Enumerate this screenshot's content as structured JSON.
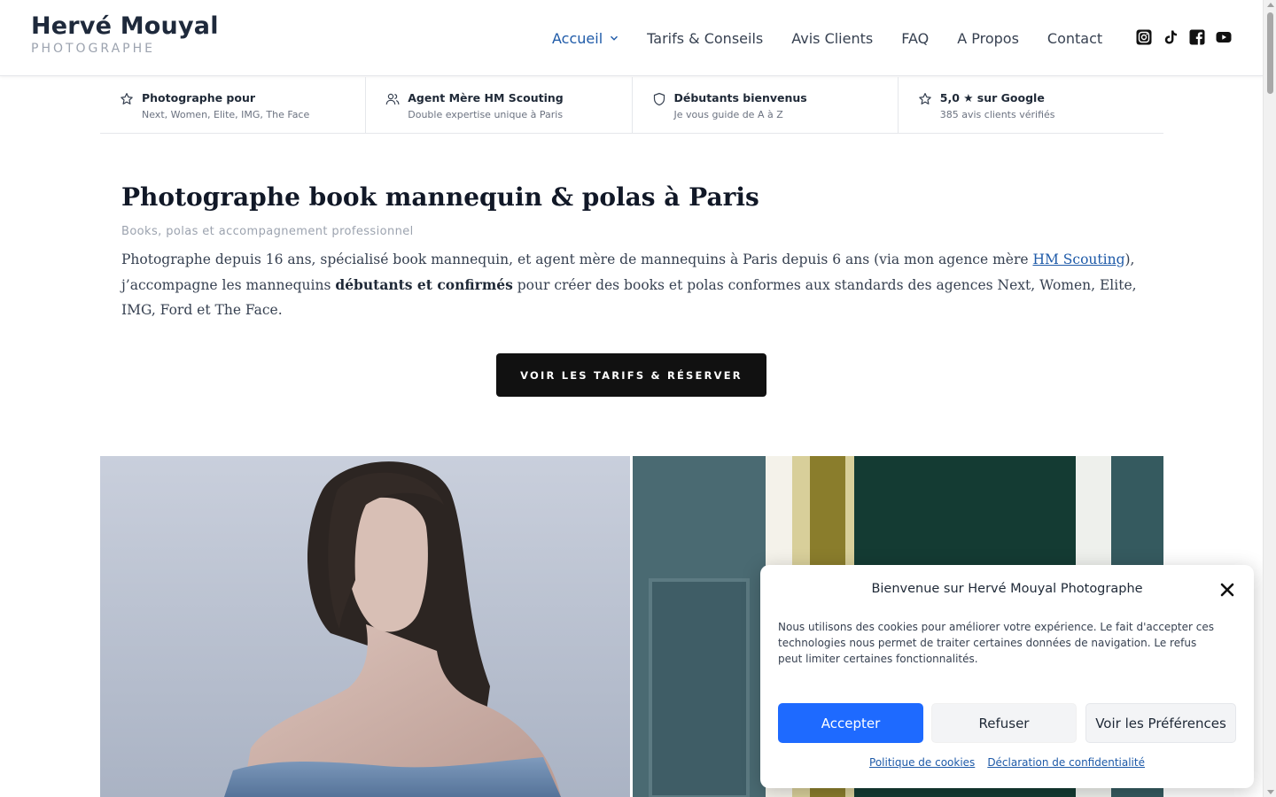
{
  "brand": {
    "name": "Hervé Mouyal",
    "tagline": "PHOTOGRAPHE"
  },
  "nav": {
    "items": [
      {
        "label": "Accueil",
        "active": true
      },
      {
        "label": "Tarifs & Conseils"
      },
      {
        "label": "Avis Clients"
      },
      {
        "label": "FAQ"
      },
      {
        "label": "A Propos"
      },
      {
        "label": "Contact"
      }
    ],
    "socials": [
      "instagram-icon",
      "tiktok-icon",
      "facebook-icon",
      "youtube-icon"
    ]
  },
  "features": [
    {
      "icon": "star-icon",
      "title": "Photographe pour",
      "sub": "Next, Women, Elite, IMG, The Face"
    },
    {
      "icon": "users-icon",
      "title": "Agent Mère HM Scouting",
      "sub": "Double expertise unique à Paris"
    },
    {
      "icon": "shield-icon",
      "title": "Débutants bienvenus",
      "sub": "Je vous guide de A à Z"
    },
    {
      "icon": "star-icon",
      "title": "5,0 ★ sur Google",
      "sub": "385 avis clients vérifiés"
    }
  ],
  "intro": {
    "title": "Photographe book mannequin & polas à Paris",
    "subtitle": "Books, polas et accompagnement professionnel",
    "para_1": "Photographe depuis 16 ans, spécialisé book mannequin, et agent mère de mannequins à Paris depuis 6 ans (via mon agence mère ",
    "para_link": "HM Scouting",
    "para_2": "), j’accompagne les mannequins ",
    "para_bold": "débutants et confirmés",
    "para_3": " pour créer des books et polas conformes aux standards des agences Next, Women, Elite, IMG, Ford et The Face.",
    "cta": "VOIR LES TARIFS & RÉSERVER"
  },
  "cookie": {
    "title": "Bienvenue sur Hervé Mouyal Photographe",
    "text": "Nous utilisons des cookies pour améliorer votre expérience. Le fait d'accepter ces technologies nous permet de traiter certaines données de navigation. Le refus peut limiter certaines fonctionnalités.",
    "accept": "Accepter",
    "refuse": "Refuser",
    "prefs": "Voir les Préférences",
    "link_cookies": "Politique de cookies",
    "link_privacy": "Déclaration de confidentialité"
  },
  "colors": {
    "accent": "#1e5aa8",
    "accept_button": "#1e6aff",
    "cta_button": "#111111"
  }
}
